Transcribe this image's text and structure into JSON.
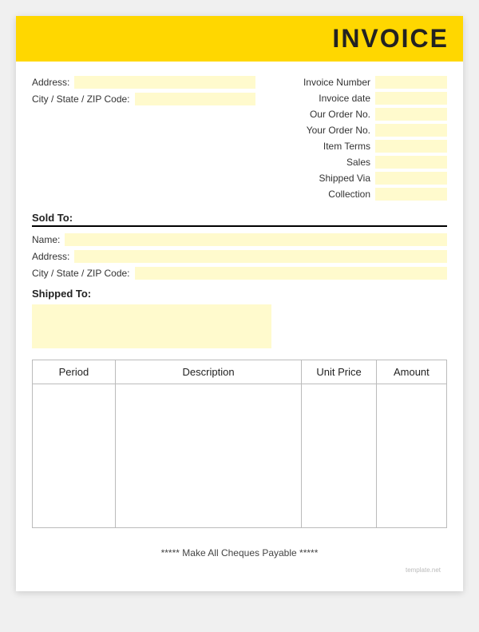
{
  "header": {
    "title": "INVOICE",
    "background": "#FFD700"
  },
  "left": {
    "address_label": "Address:",
    "city_label": "City / State / ZIP Code:",
    "sold_to_label": "Sold To:",
    "name_label": "Name:",
    "address2_label": "Address:",
    "city2_label": "City / State / ZIP Code:"
  },
  "right": {
    "fields": [
      {
        "label": "Invoice Number",
        "id": "invoice-number"
      },
      {
        "label": "Invoice date",
        "id": "invoice-date"
      },
      {
        "label": "Our Order No.",
        "id": "our-order"
      },
      {
        "label": "Your Order No.",
        "id": "your-order"
      },
      {
        "label": "Item Terms",
        "id": "item-terms"
      },
      {
        "label": "Sales",
        "id": "sales"
      },
      {
        "label": "Shipped Via",
        "id": "shipped-via"
      },
      {
        "label": "Collection",
        "id": "collection"
      }
    ]
  },
  "shipped_to": {
    "label": "Shipped To:"
  },
  "table": {
    "columns": [
      "Period",
      "Description",
      "Unit Price",
      "Amount"
    ]
  },
  "footer": {
    "text": "***** Make All Cheques Payable *****"
  },
  "watermark": "template.net"
}
